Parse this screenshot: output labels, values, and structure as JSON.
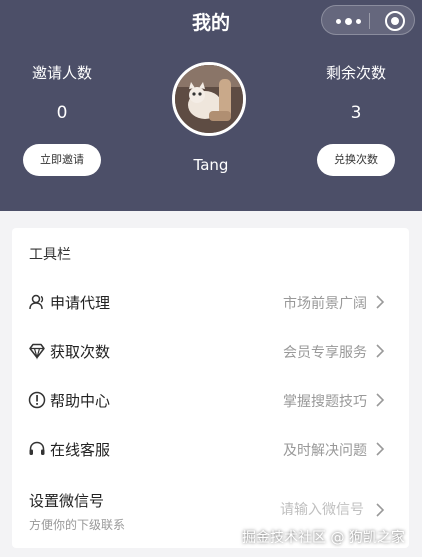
{
  "header": {
    "title": "我的",
    "background": "#4c4f68",
    "capsule_icons": [
      "more-dots-icon",
      "record-target-icon"
    ]
  },
  "stats": {
    "invite": {
      "label": "邀请人数",
      "value": "0",
      "button": "立即邀请"
    },
    "remaining": {
      "label": "剩余次数",
      "value": "3",
      "button": "兑换次数"
    }
  },
  "profile": {
    "username": "Tang",
    "avatar": "user-avatar-photo"
  },
  "toolbar": {
    "title": "工具栏",
    "items": [
      {
        "label": "申请代理",
        "sub": "市场前景广阔",
        "icon": "person-icon"
      },
      {
        "label": "获取次数",
        "sub": "会员专享服务",
        "icon": "diamond-icon"
      },
      {
        "label": "帮助中心",
        "sub": "掌握搜题技巧",
        "icon": "info-circle-icon"
      },
      {
        "label": "在线客服",
        "sub": "及时解决问题",
        "icon": "headset-icon"
      }
    ]
  },
  "wechat": {
    "label": "设置微信号",
    "hint": "方便你的下级联系",
    "placeholder": "请输入微信号"
  },
  "watermark": "掘金技术社区 @ 狗凯之家"
}
